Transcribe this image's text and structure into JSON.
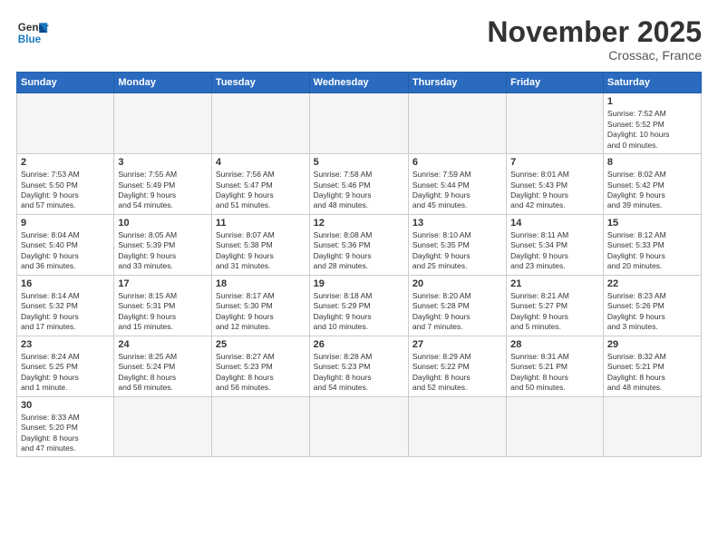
{
  "logo": {
    "line1": "General",
    "line2": "Blue"
  },
  "title": "November 2025",
  "subtitle": "Crossac, France",
  "days_header": [
    "Sunday",
    "Monday",
    "Tuesday",
    "Wednesday",
    "Thursday",
    "Friday",
    "Saturday"
  ],
  "weeks": [
    [
      {
        "day": "",
        "info": ""
      },
      {
        "day": "",
        "info": ""
      },
      {
        "day": "",
        "info": ""
      },
      {
        "day": "",
        "info": ""
      },
      {
        "day": "",
        "info": ""
      },
      {
        "day": "",
        "info": ""
      },
      {
        "day": "1",
        "info": "Sunrise: 7:52 AM\nSunset: 5:52 PM\nDaylight: 10 hours\nand 0 minutes."
      }
    ],
    [
      {
        "day": "2",
        "info": "Sunrise: 7:53 AM\nSunset: 5:50 PM\nDaylight: 9 hours\nand 57 minutes."
      },
      {
        "day": "3",
        "info": "Sunrise: 7:55 AM\nSunset: 5:49 PM\nDaylight: 9 hours\nand 54 minutes."
      },
      {
        "day": "4",
        "info": "Sunrise: 7:56 AM\nSunset: 5:47 PM\nDaylight: 9 hours\nand 51 minutes."
      },
      {
        "day": "5",
        "info": "Sunrise: 7:58 AM\nSunset: 5:46 PM\nDaylight: 9 hours\nand 48 minutes."
      },
      {
        "day": "6",
        "info": "Sunrise: 7:59 AM\nSunset: 5:44 PM\nDaylight: 9 hours\nand 45 minutes."
      },
      {
        "day": "7",
        "info": "Sunrise: 8:01 AM\nSunset: 5:43 PM\nDaylight: 9 hours\nand 42 minutes."
      },
      {
        "day": "8",
        "info": "Sunrise: 8:02 AM\nSunset: 5:42 PM\nDaylight: 9 hours\nand 39 minutes."
      }
    ],
    [
      {
        "day": "9",
        "info": "Sunrise: 8:04 AM\nSunset: 5:40 PM\nDaylight: 9 hours\nand 36 minutes."
      },
      {
        "day": "10",
        "info": "Sunrise: 8:05 AM\nSunset: 5:39 PM\nDaylight: 9 hours\nand 33 minutes."
      },
      {
        "day": "11",
        "info": "Sunrise: 8:07 AM\nSunset: 5:38 PM\nDaylight: 9 hours\nand 31 minutes."
      },
      {
        "day": "12",
        "info": "Sunrise: 8:08 AM\nSunset: 5:36 PM\nDaylight: 9 hours\nand 28 minutes."
      },
      {
        "day": "13",
        "info": "Sunrise: 8:10 AM\nSunset: 5:35 PM\nDaylight: 9 hours\nand 25 minutes."
      },
      {
        "day": "14",
        "info": "Sunrise: 8:11 AM\nSunset: 5:34 PM\nDaylight: 9 hours\nand 23 minutes."
      },
      {
        "day": "15",
        "info": "Sunrise: 8:12 AM\nSunset: 5:33 PM\nDaylight: 9 hours\nand 20 minutes."
      }
    ],
    [
      {
        "day": "16",
        "info": "Sunrise: 8:14 AM\nSunset: 5:32 PM\nDaylight: 9 hours\nand 17 minutes."
      },
      {
        "day": "17",
        "info": "Sunrise: 8:15 AM\nSunset: 5:31 PM\nDaylight: 9 hours\nand 15 minutes."
      },
      {
        "day": "18",
        "info": "Sunrise: 8:17 AM\nSunset: 5:30 PM\nDaylight: 9 hours\nand 12 minutes."
      },
      {
        "day": "19",
        "info": "Sunrise: 8:18 AM\nSunset: 5:29 PM\nDaylight: 9 hours\nand 10 minutes."
      },
      {
        "day": "20",
        "info": "Sunrise: 8:20 AM\nSunset: 5:28 PM\nDaylight: 9 hours\nand 7 minutes."
      },
      {
        "day": "21",
        "info": "Sunrise: 8:21 AM\nSunset: 5:27 PM\nDaylight: 9 hours\nand 5 minutes."
      },
      {
        "day": "22",
        "info": "Sunrise: 8:23 AM\nSunset: 5:26 PM\nDaylight: 9 hours\nand 3 minutes."
      }
    ],
    [
      {
        "day": "23",
        "info": "Sunrise: 8:24 AM\nSunset: 5:25 PM\nDaylight: 9 hours\nand 1 minute."
      },
      {
        "day": "24",
        "info": "Sunrise: 8:25 AM\nSunset: 5:24 PM\nDaylight: 8 hours\nand 58 minutes."
      },
      {
        "day": "25",
        "info": "Sunrise: 8:27 AM\nSunset: 5:23 PM\nDaylight: 8 hours\nand 56 minutes."
      },
      {
        "day": "26",
        "info": "Sunrise: 8:28 AM\nSunset: 5:23 PM\nDaylight: 8 hours\nand 54 minutes."
      },
      {
        "day": "27",
        "info": "Sunrise: 8:29 AM\nSunset: 5:22 PM\nDaylight: 8 hours\nand 52 minutes."
      },
      {
        "day": "28",
        "info": "Sunrise: 8:31 AM\nSunset: 5:21 PM\nDaylight: 8 hours\nand 50 minutes."
      },
      {
        "day": "29",
        "info": "Sunrise: 8:32 AM\nSunset: 5:21 PM\nDaylight: 8 hours\nand 48 minutes."
      }
    ],
    [
      {
        "day": "30",
        "info": "Sunrise: 8:33 AM\nSunset: 5:20 PM\nDaylight: 8 hours\nand 47 minutes."
      },
      {
        "day": "",
        "info": ""
      },
      {
        "day": "",
        "info": ""
      },
      {
        "day": "",
        "info": ""
      },
      {
        "day": "",
        "info": ""
      },
      {
        "day": "",
        "info": ""
      },
      {
        "day": "",
        "info": ""
      }
    ]
  ]
}
